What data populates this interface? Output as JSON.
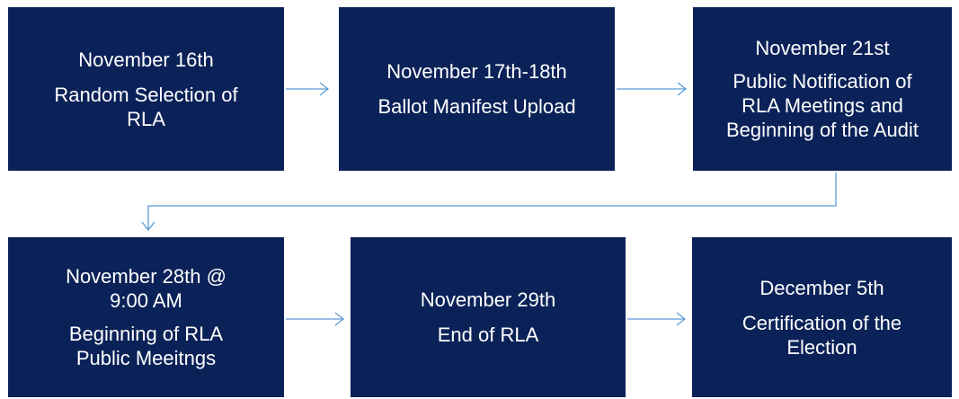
{
  "steps": [
    {
      "date_lines": [
        "November 16th"
      ],
      "desc_lines": [
        "Random Selection of",
        "RLA"
      ]
    },
    {
      "date_lines": [
        "November 17th-18th"
      ],
      "desc_lines": [
        "Ballot Manifest Upload"
      ]
    },
    {
      "date_lines": [
        "November 21st"
      ],
      "desc_lines": [
        "Public Notification of",
        "RLA Meetings and",
        "Beginning of the Audit"
      ]
    },
    {
      "date_lines": [
        "November 28th @",
        "9:00 AM"
      ],
      "desc_lines": [
        "Beginning of RLA",
        "Public Meeitngs"
      ]
    },
    {
      "date_lines": [
        "November 29th"
      ],
      "desc_lines": [
        "End of RLA"
      ]
    },
    {
      "date_lines": [
        "December 5th"
      ],
      "desc_lines": [
        "Certification of the",
        "Election"
      ]
    }
  ],
  "colors": {
    "box_fill": "#0b2258",
    "box_text": "#ffffff",
    "connector": "#5b9bd5",
    "background": "#ffffff"
  }
}
